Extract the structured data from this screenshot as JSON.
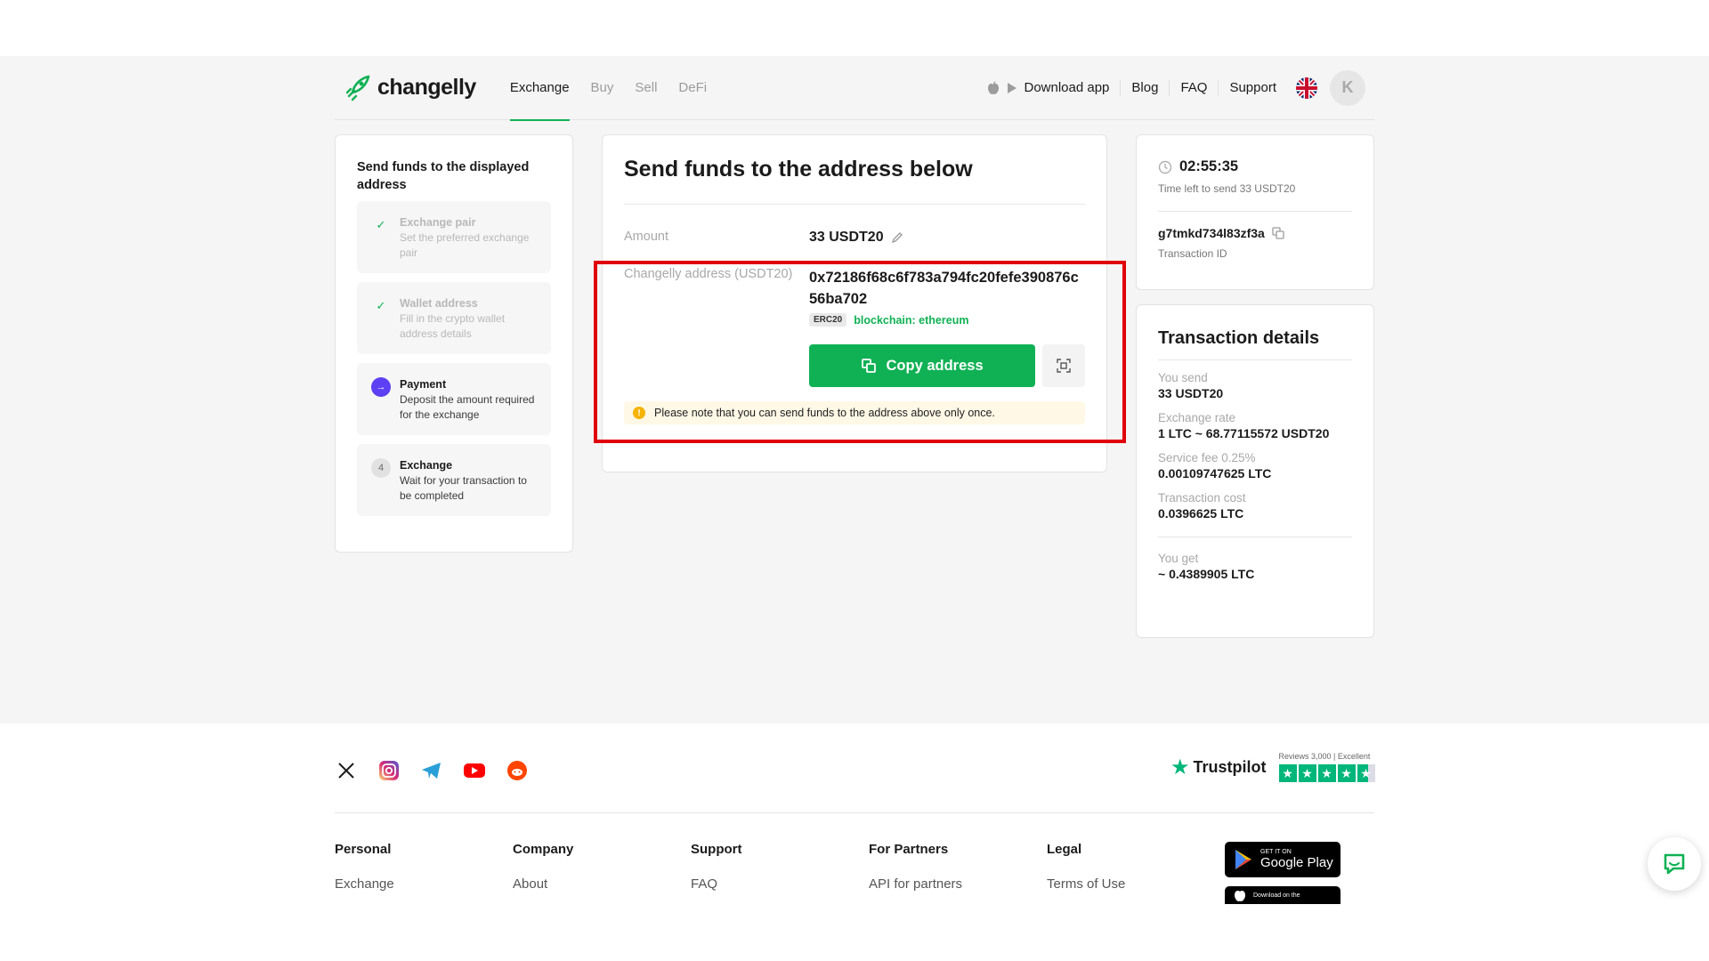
{
  "header": {
    "logo_text": "changelly",
    "nav": [
      "Exchange",
      "Buy",
      "Sell",
      "DeFi"
    ],
    "download_app": "Download app",
    "links": [
      "Blog",
      "FAQ",
      "Support"
    ],
    "avatar_initial": "K"
  },
  "steps": {
    "title": "Send funds to the displayed address",
    "items": [
      {
        "title": "Exchange pair",
        "subtitle": "Set the preferred exchange pair"
      },
      {
        "title": "Wallet address",
        "subtitle": "Fill in the crypto wallet address details"
      },
      {
        "title": "Payment",
        "subtitle": "Deposit the amount required for the exchange",
        "icon": "→"
      },
      {
        "title": "Exchange",
        "subtitle": "Wait for your transaction to be completed",
        "icon": "4"
      }
    ]
  },
  "main": {
    "title": "Send funds to the address below",
    "amount_label": "Amount",
    "amount_value": "33 USDT20",
    "address_label": "Changelly address (USDT20)",
    "address_value": "0x72186f68c6f783a794fc20fefe390876c56ba702",
    "token_standard": "ERC20",
    "blockchain": "blockchain: ethereum",
    "copy_button": "Copy address",
    "note": "Please note that you can send funds to the address above only once."
  },
  "timer": {
    "time": "02:55:35",
    "time_caption": "Time left to send 33 USDT20",
    "transaction_id": "g7tmkd734l83zf3a",
    "transaction_caption": "Transaction ID"
  },
  "details": {
    "title": "Transaction details",
    "you_send_label": "You send",
    "you_send": "33 USDT20",
    "rate_label": "Exchange rate",
    "rate": "1 LTC ~ 68.77115572 USDT20",
    "fee_label": "Service fee 0.25%",
    "fee": "0.00109747625 LTC",
    "cost_label": "Transaction cost",
    "cost": "0.0396625 LTC",
    "you_get_label": "You get",
    "you_get": "~ 0.4389905 LTC"
  },
  "footer": {
    "trustpilot": "Trustpilot",
    "reviews": "Reviews 3,000 | Excellent",
    "columns": [
      {
        "heading": "Personal",
        "link": "Exchange"
      },
      {
        "heading": "Company",
        "link": "About"
      },
      {
        "heading": "Support",
        "link": "FAQ"
      },
      {
        "heading": "For Partners",
        "link": "API for partners"
      },
      {
        "heading": "Legal",
        "link": "Terms of Use"
      }
    ],
    "google_play_top": "GET IT ON",
    "google_play": "Google Play",
    "app_store_top": "Download on the"
  },
  "colors": {
    "accent_green": "#10b154",
    "step_purple": "#5d3ff4",
    "highlight_red": "#e0000a",
    "trustpilot_green": "#00b67a"
  }
}
